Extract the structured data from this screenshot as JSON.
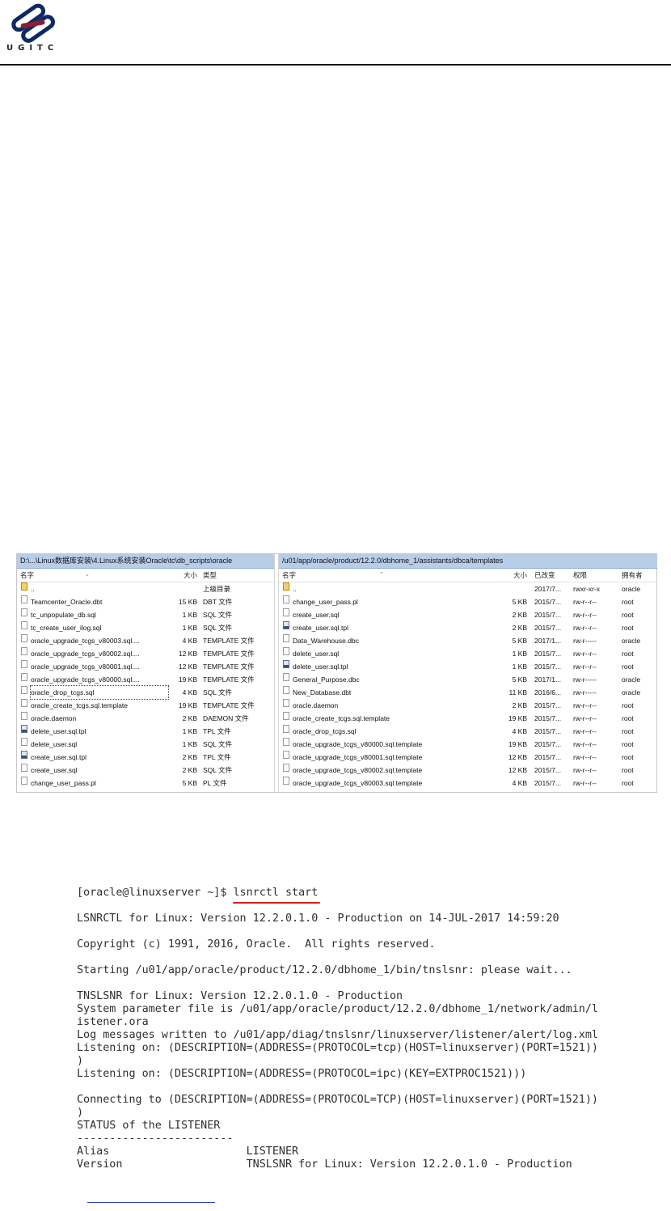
{
  "brand": {
    "logo_text": "UGITC",
    "colors": {
      "primary": "#0c2a63",
      "accent": "#8b1c32"
    }
  },
  "file_manager": {
    "left": {
      "path": "D:\\...\\Linux数据库安装\\4.Linux系统安装Oracle\\tc\\db_scripts\\oracle",
      "headers": {
        "name": "名字",
        "size": "大小",
        "type": "类型"
      },
      "rows": [
        {
          "name": "..",
          "size": "",
          "type": "上级目录",
          "icon": "parent-dir-icon"
        },
        {
          "name": "Teamcenter_Oracle.dbt",
          "size": "15 KB",
          "type": "DBT 文件",
          "icon": "file-icon"
        },
        {
          "name": "tc_unpopulate_db.sql",
          "size": "1 KB",
          "type": "SQL 文件",
          "icon": "file-icon"
        },
        {
          "name": "tc_create_user_ilog.sql",
          "size": "1 KB",
          "type": "SQL 文件",
          "icon": "file-icon"
        },
        {
          "name": "oracle_upgrade_tcgs_v80003.sql....",
          "size": "4 KB",
          "type": "TEMPLATE 文件",
          "icon": "file-icon"
        },
        {
          "name": "oracle_upgrade_tcgs_v80002.sql....",
          "size": "12 KB",
          "type": "TEMPLATE 文件",
          "icon": "file-icon"
        },
        {
          "name": "oracle_upgrade_tcgs_v80001.sql....",
          "size": "12 KB",
          "type": "TEMPLATE 文件",
          "icon": "file-icon"
        },
        {
          "name": "oracle_upgrade_tcgs_v80000.sql....",
          "size": "19 KB",
          "type": "TEMPLATE 文件",
          "icon": "file-icon"
        },
        {
          "name": "oracle_drop_tcgs.sql",
          "size": "4 KB",
          "type": "SQL 文件",
          "icon": "file-icon",
          "focused": true
        },
        {
          "name": "oracle_create_tcgs.sql.template",
          "size": "19 KB",
          "type": "TEMPLATE 文件",
          "icon": "file-icon"
        },
        {
          "name": "oracle.daemon",
          "size": "2 KB",
          "type": "DAEMON 文件",
          "icon": "file-icon"
        },
        {
          "name": "delete_user.sql.tpl",
          "size": "1 KB",
          "type": "TPL 文件",
          "icon": "template-file-icon"
        },
        {
          "name": "delete_user.sql",
          "size": "1 KB",
          "type": "SQL 文件",
          "icon": "file-icon"
        },
        {
          "name": "create_user.sql.tpl",
          "size": "2 KB",
          "type": "TPL 文件",
          "icon": "template-file-icon"
        },
        {
          "name": "create_user.sql",
          "size": "2 KB",
          "type": "SQL 文件",
          "icon": "file-icon"
        },
        {
          "name": "change_user_pass.pl",
          "size": "5 KB",
          "type": "PL 文件",
          "icon": "file-icon"
        }
      ]
    },
    "right": {
      "path": "/u01/app/oracle/product/12.2.0/dbhome_1/assistants/dbca/templates",
      "headers": {
        "name": "名字",
        "size": "大小",
        "modified": "已改变",
        "perms": "权限",
        "owner": "拥有者"
      },
      "rows": [
        {
          "name": "..",
          "size": "",
          "modified": "2017/7...",
          "perms": "rwxr-xr-x",
          "owner": "oracle",
          "icon": "parent-dir-icon"
        },
        {
          "name": "change_user_pass.pl",
          "size": "5 KB",
          "modified": "2015/7...",
          "perms": "rw-r--r--",
          "owner": "root",
          "icon": "file-icon"
        },
        {
          "name": "create_user.sql",
          "size": "2 KB",
          "modified": "2015/7...",
          "perms": "rw-r--r--",
          "owner": "root",
          "icon": "file-icon"
        },
        {
          "name": "create_user.sql.tpl",
          "size": "2 KB",
          "modified": "2015/7...",
          "perms": "rw-r--r--",
          "owner": "root",
          "icon": "template-file-icon"
        },
        {
          "name": "Data_Warehouse.dbc",
          "size": "5 KB",
          "modified": "2017/1...",
          "perms": "rw-r-----",
          "owner": "oracle",
          "icon": "file-icon"
        },
        {
          "name": "delete_user.sql",
          "size": "1 KB",
          "modified": "2015/7...",
          "perms": "rw-r--r--",
          "owner": "root",
          "icon": "file-icon"
        },
        {
          "name": "delete_user.sql.tpl",
          "size": "1 KB",
          "modified": "2015/7...",
          "perms": "rw-r--r--",
          "owner": "root",
          "icon": "template-file-icon"
        },
        {
          "name": "General_Purpose.dbc",
          "size": "5 KB",
          "modified": "2017/1...",
          "perms": "rw-r-----",
          "owner": "oracle",
          "icon": "file-icon"
        },
        {
          "name": "New_Database.dbt",
          "size": "11 KB",
          "modified": "2016/6...",
          "perms": "rw-r-----",
          "owner": "oracle",
          "icon": "file-icon"
        },
        {
          "name": "oracle.daemon",
          "size": "2 KB",
          "modified": "2015/7...",
          "perms": "rw-r--r--",
          "owner": "root",
          "icon": "file-icon"
        },
        {
          "name": "oracle_create_tcgs.sql.template",
          "size": "19 KB",
          "modified": "2015/7...",
          "perms": "rw-r--r--",
          "owner": "root",
          "icon": "file-icon"
        },
        {
          "name": "oracle_drop_tcgs.sql",
          "size": "4 KB",
          "modified": "2015/7...",
          "perms": "rw-r--r--",
          "owner": "root",
          "icon": "file-icon"
        },
        {
          "name": "oracle_upgrade_tcgs_v80000.sql.template",
          "size": "19 KB",
          "modified": "2015/7...",
          "perms": "rw-r--r--",
          "owner": "root",
          "icon": "file-icon"
        },
        {
          "name": "oracle_upgrade_tcgs_v80001.sql.template",
          "size": "12 KB",
          "modified": "2015/7...",
          "perms": "rw-r--r--",
          "owner": "root",
          "icon": "file-icon"
        },
        {
          "name": "oracle_upgrade_tcgs_v80002.sql.template",
          "size": "12 KB",
          "modified": "2015/7...",
          "perms": "rw-r--r--",
          "owner": "root",
          "icon": "file-icon"
        },
        {
          "name": "oracle_upgrade_tcgs_v80003.sql.template",
          "size": "4 KB",
          "modified": "2015/7...",
          "perms": "rw-r--r--",
          "owner": "root",
          "icon": "file-icon"
        }
      ]
    }
  },
  "terminal": {
    "prompt": "[oracle@linuxserver ~]$ ",
    "command": "lsnrctl start",
    "lines": [
      "LSNRCTL for Linux: Version 12.2.0.1.0 - Production on 14-JUL-2017 14:59:20",
      "",
      "Copyright (c) 1991, 2016, Oracle.  All rights reserved.",
      "",
      "Starting /u01/app/oracle/product/12.2.0/dbhome_1/bin/tnslsnr: please wait...",
      "",
      "TNSLSNR for Linux: Version 12.2.0.1.0 - Production",
      "System parameter file is /u01/app/oracle/product/12.2.0/dbhome_1/network/admin/l",
      "istener.ora",
      "Log messages written to /u01/app/diag/tnslsnr/linuxserver/listener/alert/log.xml",
      "Listening on: (DESCRIPTION=(ADDRESS=(PROTOCOL=tcp)(HOST=linuxserver)(PORT=1521))",
      ")",
      "Listening on: (DESCRIPTION=(ADDRESS=(PROTOCOL=ipc)(KEY=EXTPROC1521)))",
      "",
      "Connecting to (DESCRIPTION=(ADDRESS=(PROTOCOL=TCP)(HOST=linuxserver)(PORT=1521))",
      ")",
      "STATUS of the LISTENER",
      "------------------------",
      "Alias                     LISTENER",
      "Version                   TNSLSNR for Linux: Version 12.2.0.1.0 - Production"
    ]
  }
}
